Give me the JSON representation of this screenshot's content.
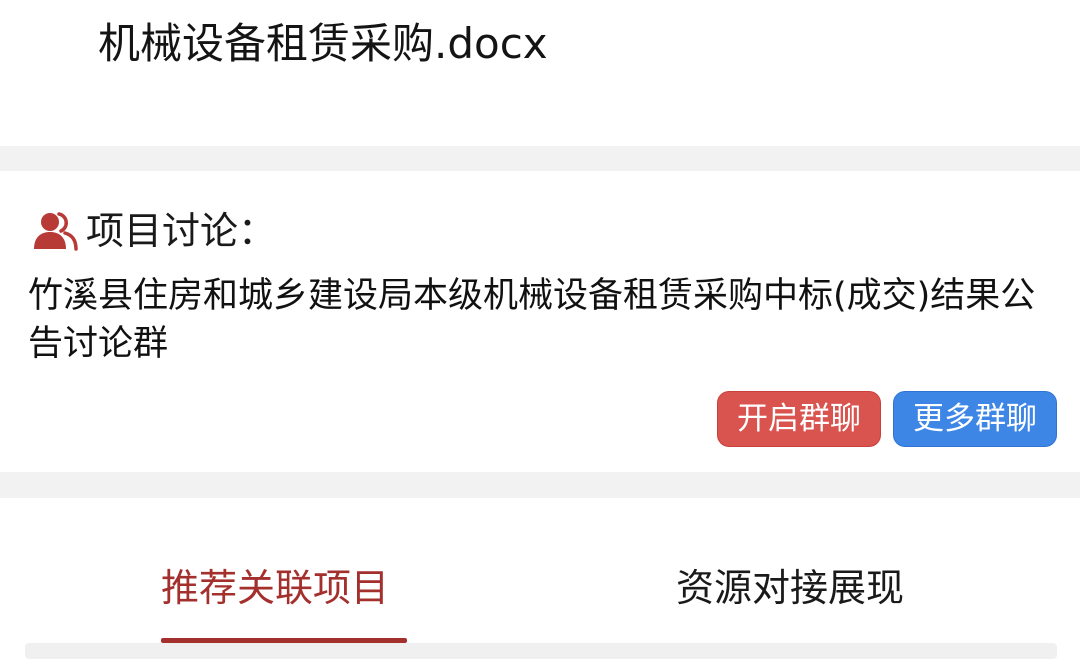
{
  "file": {
    "name": "机械设备租赁采购.docx"
  },
  "discussion": {
    "icon": "users-icon",
    "title": "项目讨论：",
    "description": "竹溪县住房和城乡建设局本级机械设备租赁采购中标(成交)结果公告讨论群",
    "open_button": "开启群聊",
    "more_button": "更多群聊"
  },
  "tabs": [
    {
      "label": "推荐关联项目",
      "active": true
    },
    {
      "label": "资源对接展现",
      "active": false
    }
  ],
  "colors": {
    "accent": "#a3302d",
    "open_button": "#d9534f",
    "more_button": "#3d86e6",
    "icon": "#b83a36"
  }
}
